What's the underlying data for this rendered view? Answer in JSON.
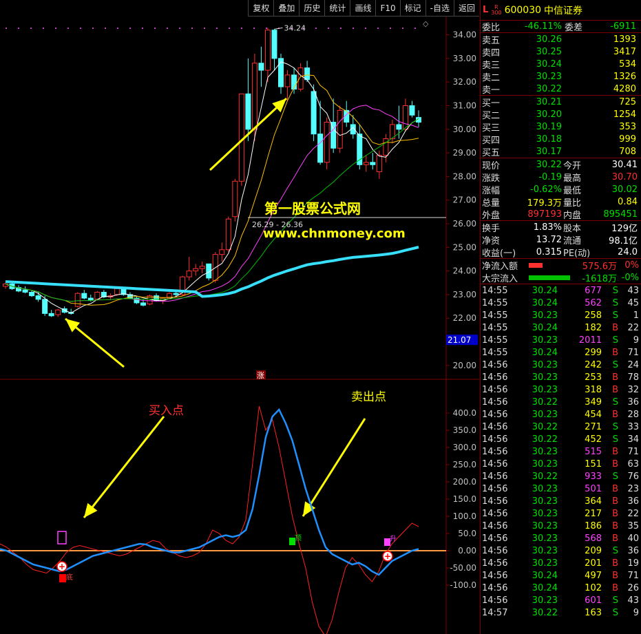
{
  "toolbar": {
    "buttons": [
      "复权",
      "叠加",
      "历史",
      "统计",
      "画线",
      "F10",
      "标记",
      "-自选",
      "返回"
    ]
  },
  "kline": {
    "yaxis": {
      "min": 19.5,
      "max": 34.6,
      "ticks": [
        "34.00",
        "33.00",
        "32.00",
        "31.00",
        "30.00",
        "29.00",
        "28.00",
        "27.00",
        "26.00",
        "25.00",
        "24.00",
        "23.00",
        "22.00",
        "21.00",
        "20.00"
      ]
    },
    "high_label": "34.24",
    "mid_label": "26.29 - 26.36",
    "price_tag": "21.07",
    "zhang_mark": "涨",
    "watermark_title": "第一股票公式网",
    "watermark_url": "www.chnmoney.com",
    "candles": [
      [
        23.35,
        23.5,
        23.25,
        23.45
      ],
      [
        23.45,
        23.55,
        23.2,
        23.25
      ],
      [
        23.3,
        23.4,
        23.1,
        23.15
      ],
      [
        23.2,
        23.35,
        23.05,
        23.1
      ],
      [
        23.1,
        23.2,
        22.9,
        22.95
      ],
      [
        22.95,
        23.1,
        22.7,
        22.8
      ],
      [
        22.8,
        22.95,
        22.1,
        22.2
      ],
      [
        22.2,
        22.35,
        22.05,
        22.1
      ],
      [
        22.15,
        22.4,
        22.05,
        22.35
      ],
      [
        22.4,
        22.5,
        22.2,
        22.25
      ],
      [
        22.25,
        22.4,
        22.15,
        22.2
      ],
      [
        22.5,
        23.1,
        22.45,
        23.05
      ],
      [
        23.05,
        23.2,
        22.8,
        22.85
      ],
      [
        22.85,
        23.0,
        22.7,
        22.75
      ],
      [
        22.8,
        23.15,
        22.75,
        23.1
      ],
      [
        23.1,
        23.2,
        22.85,
        22.9
      ],
      [
        22.9,
        23.05,
        22.8,
        22.95
      ],
      [
        23.0,
        23.3,
        22.95,
        23.25
      ],
      [
        23.25,
        23.3,
        22.95,
        23.0
      ],
      [
        23.0,
        23.1,
        22.8,
        22.85
      ],
      [
        22.85,
        22.95,
        22.6,
        22.65
      ],
      [
        22.65,
        22.8,
        22.5,
        22.55
      ],
      [
        22.6,
        23.0,
        22.55,
        22.95
      ],
      [
        22.95,
        23.05,
        22.7,
        22.75
      ],
      [
        22.75,
        22.9,
        22.6,
        22.85
      ],
      [
        22.85,
        23.1,
        22.8,
        23.05
      ],
      [
        23.05,
        23.2,
        22.9,
        23.0
      ],
      [
        23.0,
        23.8,
        22.95,
        23.75
      ],
      [
        23.75,
        24.6,
        23.6,
        24.0
      ],
      [
        24.0,
        24.3,
        23.8,
        24.1
      ],
      [
        24.1,
        24.4,
        23.9,
        24.2
      ],
      [
        24.3,
        24.2,
        23.6,
        23.7
      ],
      [
        23.6,
        24.8,
        23.5,
        24.7
      ],
      [
        24.7,
        25.2,
        24.4,
        24.9
      ],
      [
        24.9,
        26.3,
        24.8,
        26.2
      ],
      [
        26.3,
        27.9,
        26.1,
        27.8
      ],
      [
        27.8,
        31.2,
        27.6,
        31.5
      ],
      [
        31.5,
        33.0,
        29.5,
        30.0
      ],
      [
        30.0,
        33.2,
        29.5,
        32.8
      ],
      [
        32.8,
        33.5,
        31.8,
        32.5
      ],
      [
        32.5,
        34.3,
        32.0,
        34.2
      ],
      [
        34.2,
        34.24,
        32.5,
        33.0
      ],
      [
        33.0,
        33.2,
        31.5,
        31.8
      ],
      [
        31.8,
        32.5,
        31.2,
        32.3
      ],
      [
        32.3,
        32.6,
        31.5,
        31.7
      ],
      [
        31.7,
        32.8,
        31.6,
        32.6
      ],
      [
        32.6,
        32.9,
        32.0,
        32.1
      ],
      [
        31.6,
        31.9,
        29.5,
        29.8
      ],
      [
        29.8,
        31.2,
        28.5,
        28.6
      ],
      [
        28.6,
        30.5,
        28.3,
        30.3
      ],
      [
        30.3,
        31.3,
        29.0,
        29.2
      ],
      [
        29.2,
        31.0,
        29.0,
        30.8
      ],
      [
        30.8,
        31.2,
        30.1,
        30.3
      ],
      [
        30.2,
        30.6,
        29.6,
        29.8
      ],
      [
        29.8,
        30.2,
        28.3,
        28.5
      ],
      [
        28.5,
        28.9,
        28.2,
        28.6
      ],
      [
        28.6,
        29.0,
        28.3,
        28.5
      ],
      [
        28.2,
        29.1,
        27.9,
        28.9
      ],
      [
        28.9,
        29.8,
        28.6,
        29.6
      ],
      [
        29.6,
        30.4,
        29.4,
        30.2
      ],
      [
        30.2,
        31.0,
        29.6,
        30.0
      ],
      [
        30.0,
        31.3,
        29.9,
        31.0
      ],
      [
        31.0,
        31.2,
        30.5,
        30.6
      ],
      [
        30.5,
        30.8,
        30.1,
        30.3
      ]
    ]
  },
  "indicator": {
    "yaxis": {
      "min": -200,
      "max": 480,
      "ticks": [
        "400.0",
        "350.0",
        "300.0",
        "250.0",
        "200.0",
        "150.0",
        "100.0",
        "50.0",
        "0.00",
        "-50.00",
        "-100.0"
      ]
    },
    "buy_label": "买入点",
    "sell_label": "卖出点",
    "mark_ding": "顶",
    "mark_sheng": "升",
    "mark_di": "底",
    "red_line": [
      20,
      10,
      -5,
      -20,
      -40,
      -55,
      -60,
      -65,
      -50,
      -30,
      -5,
      10,
      15,
      10,
      5,
      0,
      -5,
      -10,
      -15,
      -10,
      0,
      10,
      20,
      30,
      25,
      5,
      -5,
      -15,
      -20,
      -15,
      -5,
      20,
      60,
      50,
      30,
      20,
      40,
      90,
      250,
      420,
      350,
      380,
      300,
      200,
      100,
      20,
      -50,
      -150,
      -220,
      -250,
      -200,
      -120,
      -50,
      -20,
      -40,
      -70,
      -90,
      -60,
      -10,
      20,
      40,
      60,
      80,
      70
    ],
    "blue_line": [
      5,
      0,
      -10,
      -20,
      -30,
      -40,
      -45,
      -50,
      -55,
      -60,
      -55,
      -45,
      -35,
      -25,
      -15,
      -10,
      -5,
      0,
      5,
      10,
      15,
      20,
      18,
      10,
      5,
      0,
      -5,
      -5,
      0,
      5,
      10,
      20,
      30,
      40,
      45,
      40,
      45,
      60,
      120,
      220,
      330,
      390,
      410,
      370,
      320,
      250,
      180,
      120,
      60,
      10,
      -10,
      -20,
      -30,
      -40,
      -35,
      -45,
      -60,
      -70,
      -50,
      -30,
      -20,
      -10,
      0,
      5
    ]
  },
  "quote": {
    "flag": "L",
    "flag_sub": "R",
    "flag_num": "300",
    "code": "600030",
    "name": "中信证券",
    "weibi": {
      "label": "委比",
      "value": "-46.11%",
      "label2": "委差",
      "value2": "-6911"
    },
    "sells": [
      {
        "label": "卖五",
        "price": "30.26",
        "vol": "1393"
      },
      {
        "label": "卖四",
        "price": "30.25",
        "vol": "3417"
      },
      {
        "label": "卖三",
        "price": "30.24",
        "vol": "534"
      },
      {
        "label": "卖二",
        "price": "30.23",
        "vol": "1326"
      },
      {
        "label": "卖一",
        "price": "30.22",
        "vol": "4280"
      }
    ],
    "buys": [
      {
        "label": "买一",
        "price": "30.21",
        "vol": "725"
      },
      {
        "label": "买二",
        "price": "30.20",
        "vol": "1254"
      },
      {
        "label": "买三",
        "price": "30.19",
        "vol": "353"
      },
      {
        "label": "买四",
        "price": "30.18",
        "vol": "999"
      },
      {
        "label": "买五",
        "price": "30.17",
        "vol": "708"
      }
    ],
    "stats": [
      {
        "a": "现价",
        "b": "30.22",
        "bc": "g",
        "c": "今开",
        "d": "30.41",
        "dc": "w"
      },
      {
        "a": "涨跌",
        "b": "-0.19",
        "bc": "g",
        "c": "最高",
        "d": "30.70",
        "dc": "r"
      },
      {
        "a": "涨幅",
        "b": "-0.62%",
        "bc": "g",
        "c": "最低",
        "d": "30.02",
        "dc": "g"
      },
      {
        "a": "总量",
        "b": "179.3万",
        "bc": "y",
        "c": "量比",
        "d": "0.84",
        "dc": "y"
      },
      {
        "a": "外盘",
        "b": "897193",
        "bc": "r",
        "c": "内盘",
        "d": "895451",
        "dc": "g"
      }
    ],
    "stats2": [
      {
        "a": "换手",
        "b": "1.83%",
        "bc": "w",
        "c": "股本",
        "d": "129亿",
        "dc": "w"
      },
      {
        "a": "净资",
        "b": "13.72",
        "bc": "w",
        "c": "流通",
        "d": "98.1亿",
        "dc": "w"
      },
      {
        "a": "收益(一)",
        "b": "0.315",
        "bc": "w",
        "c": "PE(动)",
        "d": "24.0",
        "dc": "w"
      }
    ],
    "flows": [
      {
        "label": "净流入额",
        "value": "575.6万",
        "pct": "0%",
        "color": "#ff3030",
        "bar": 20,
        "vc": "r"
      },
      {
        "label": "大宗流入",
        "value": "-1618万",
        "pct": "-0%",
        "color": "#00c000",
        "bar": 60,
        "vc": "g"
      }
    ],
    "ticks": [
      [
        "14:55",
        "30.24",
        "677",
        "S",
        "43"
      ],
      [
        "14:55",
        "30.24",
        "562",
        "S",
        "45"
      ],
      [
        "14:55",
        "30.23",
        "258",
        "S",
        "1"
      ],
      [
        "14:55",
        "30.24",
        "182",
        "B",
        "22"
      ],
      [
        "14:55",
        "30.23",
        "2011",
        "S",
        "9"
      ],
      [
        "14:55",
        "30.24",
        "299",
        "B",
        "71"
      ],
      [
        "14:56",
        "30.23",
        "242",
        "S",
        "24"
      ],
      [
        "14:56",
        "30.23",
        "253",
        "B",
        "78"
      ],
      [
        "14:56",
        "30.23",
        "318",
        "B",
        "32"
      ],
      [
        "14:56",
        "30.22",
        "349",
        "S",
        "36"
      ],
      [
        "14:56",
        "30.23",
        "454",
        "B",
        "28"
      ],
      [
        "14:56",
        "30.22",
        "271",
        "S",
        "33"
      ],
      [
        "14:56",
        "30.22",
        "452",
        "S",
        "34"
      ],
      [
        "14:56",
        "30.23",
        "515",
        "B",
        "71"
      ],
      [
        "14:56",
        "30.23",
        "151",
        "B",
        "63"
      ],
      [
        "14:56",
        "30.22",
        "933",
        "S",
        "76"
      ],
      [
        "14:56",
        "30.23",
        "501",
        "B",
        "23"
      ],
      [
        "14:56",
        "30.23",
        "364",
        "B",
        "36"
      ],
      [
        "14:56",
        "30.23",
        "217",
        "B",
        "22"
      ],
      [
        "14:56",
        "30.23",
        "186",
        "B",
        "35"
      ],
      [
        "14:56",
        "30.23",
        "568",
        "B",
        "40"
      ],
      [
        "14:56",
        "30.23",
        "209",
        "S",
        "36"
      ],
      [
        "14:56",
        "30.23",
        "201",
        "B",
        "19"
      ],
      [
        "14:56",
        "30.24",
        "497",
        "B",
        "71"
      ],
      [
        "14:56",
        "30.24",
        "102",
        "B",
        "26"
      ],
      [
        "14:56",
        "30.23",
        "601",
        "S",
        "43"
      ],
      [
        "14:57",
        "30.22",
        "163",
        "S",
        "9"
      ]
    ]
  }
}
